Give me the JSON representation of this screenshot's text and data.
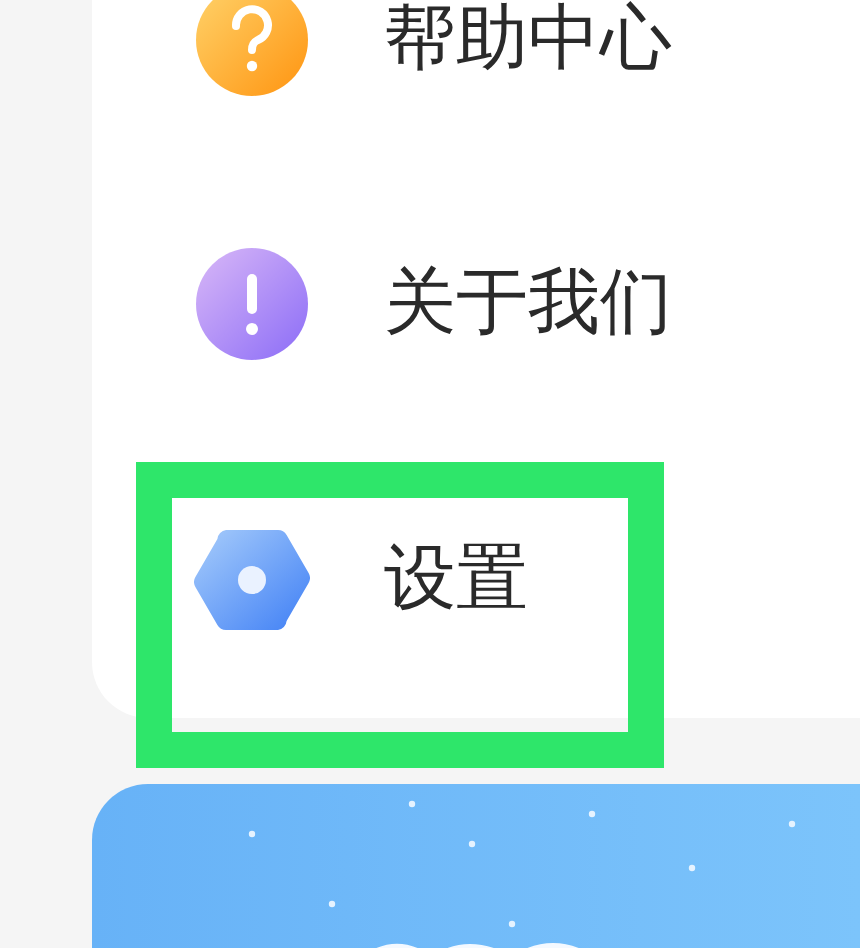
{
  "menu": {
    "items": [
      {
        "kind": "help",
        "label": "帮助中心",
        "selected": false
      },
      {
        "kind": "about",
        "label": "关于我们",
        "selected": false
      },
      {
        "kind": "settings",
        "label": "设置",
        "selected": true
      }
    ]
  }
}
